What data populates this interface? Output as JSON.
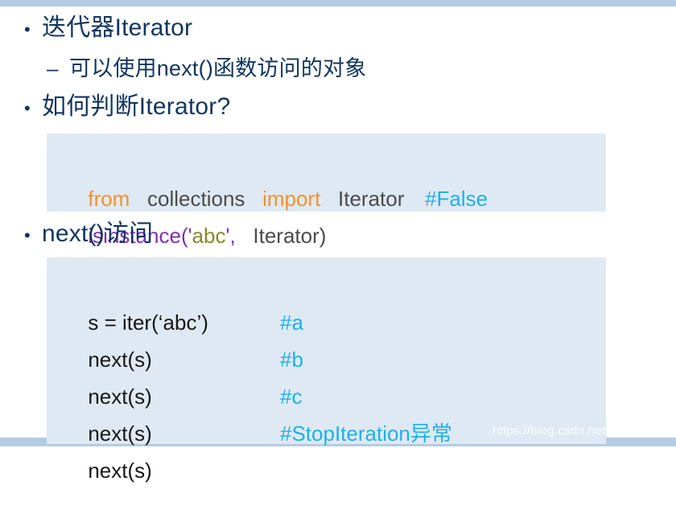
{
  "slide": {
    "decor": {
      "top_band_color": "#b4cbe3",
      "bottom_band_color": "#b4cbe3"
    },
    "bullet_marker": "•",
    "sub_bullet_marker": "–",
    "bullets": [
      {
        "text": "迭代器Iterator"
      },
      {
        "text": "如何判断Iterator?"
      },
      {
        "text": "next()访问"
      }
    ],
    "sub_bullets": [
      {
        "text": "可以使用next()函数访问的对象"
      }
    ],
    "code_block_1": {
      "background": "#dfe9f4",
      "lines": [
        {
          "tokens": [
            {
              "text": "from",
              "kind": "keyword"
            },
            {
              "text": "   collections   ",
              "kind": "plain"
            },
            {
              "text": "import",
              "kind": "keyword"
            },
            {
              "text": "   Iterator",
              "kind": "plain"
            }
          ],
          "comment": ""
        },
        {
          "tokens": [
            {
              "text": "isinstance",
              "kind": "func"
            },
            {
              "text": "('",
              "kind": "punct"
            },
            {
              "text": "abc",
              "kind": "string"
            },
            {
              "text": "',",
              "kind": "punct"
            },
            {
              "text": "   Iterator)",
              "kind": "plain"
            }
          ],
          "comment": "#False"
        }
      ]
    },
    "code_block_2": {
      "background": "#dfe9f4",
      "lines": [
        {
          "code": "s = iter(‘abc’)",
          "comment": ""
        },
        {
          "code": "next(s)",
          "comment": "#a"
        },
        {
          "code": "next(s)",
          "comment": "#b"
        },
        {
          "code": "next(s)",
          "comment": "#c"
        },
        {
          "code": "next(s)",
          "comment": "#StopIteration异常"
        }
      ]
    },
    "watermark": "https://blog.csdn.net/gongranr",
    "colors": {
      "heading_text": "#11355e",
      "code_bg": "#dfe9f4",
      "keyword": "#f2912e",
      "function": "#7b2fb5",
      "string": "#85892b",
      "comment": "#1fb0ec",
      "plain": "#4b4b4b",
      "band": "#b4cbe3"
    }
  }
}
